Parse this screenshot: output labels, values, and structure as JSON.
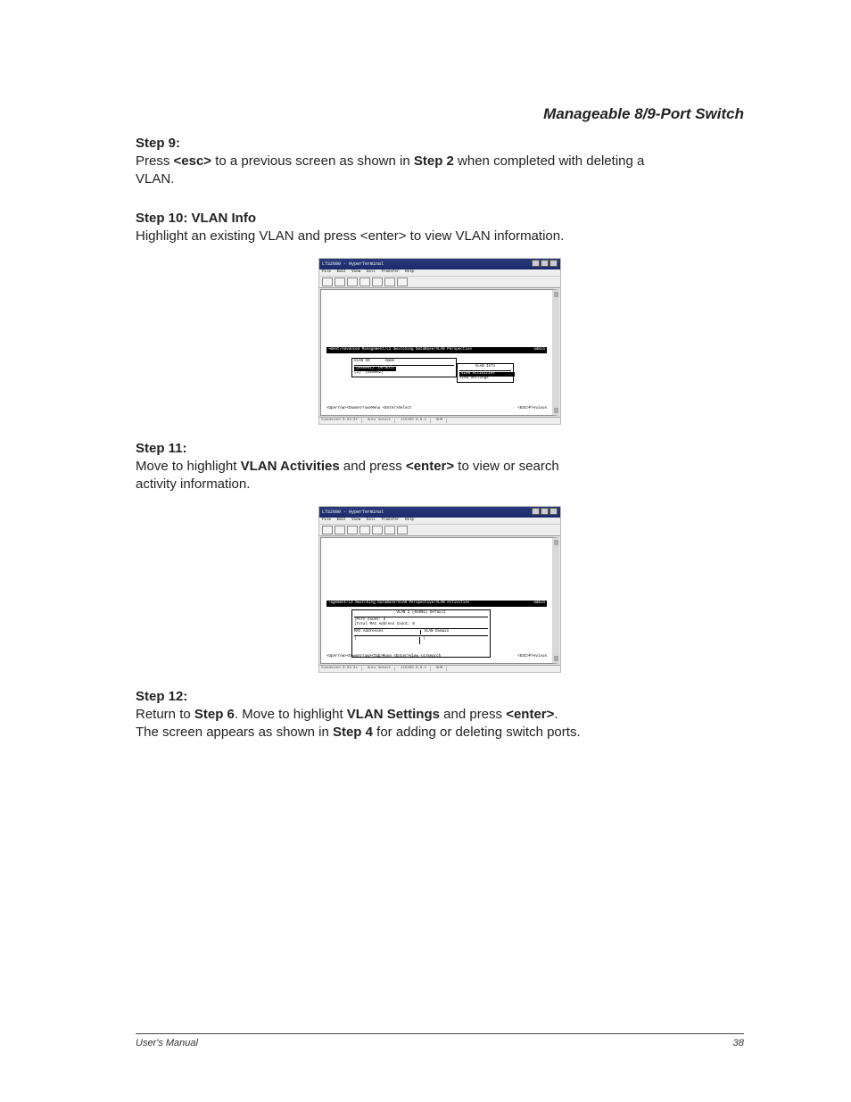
{
  "header": {
    "title": "Manageable 8/9-Port Switch"
  },
  "steps": {
    "s9": {
      "head": "Step 9:",
      "l1a": "Press  ",
      "esc": "<esc>",
      "l1b": "  to a previous screen as shown in ",
      "ref": "Step 2",
      "l1c": " when completed with deleting a",
      "l2": "VLAN."
    },
    "s10": {
      "head": "Step 10: VLAN Info",
      "l1": "Highlight an existing VLAN and press <enter> to view VLAN information."
    },
    "s11": {
      "head": "Step 11:",
      "l1a": "Move to highlight ",
      "b1": "VLAN Activities",
      "l1b": " and press ",
      "b2": "<enter>",
      "l1c": " to view or search",
      "l2": "activity information."
    },
    "s12": {
      "head": "Step 12:",
      "l1a": "Return to ",
      "b1": "Step 6",
      "l1b": ". Move to highlight ",
      "b2": "VLAN Settings",
      "l1c": " and press ",
      "b3": "<enter>",
      "l1d": ".",
      "l2a": "The screen appears as shown in ",
      "b4": "Step 4",
      "l2b": " for adding or deleting switch ports."
    }
  },
  "term_common": {
    "app_title": "LTS2600 - HyperTerminal",
    "menu_file": "File",
    "menu_edit": "Edit",
    "menu_view": "View",
    "menu_call": "Call",
    "menu_transfer": "Transfer",
    "menu_help": "Help",
    "status_conn": "Connected 0:04:34",
    "status_auto": "Auto detect",
    "status_baud": "115200 8-N-1",
    "status_num": "NUM",
    "user": "admin",
    "esc": "<ESC>Previous"
  },
  "shot1": {
    "crumb": "~ment/Advanced Management/L2 Switching DataBase/VLAN Perspective",
    "col_id": "VLAN ID",
    "col_name": "Name",
    "row_id1": "(0x0001)",
    "row_name1": "Default",
    "row_id2": "(0x0002)",
    "panel_title": "VLAN Info",
    "panel_act": "VLAN Activities",
    "panel_set": "VLAN Settings",
    "help": "<UpArrow><DownArrow>Menu  <Enter>Select"
  },
  "shot2": {
    "crumb": "~agement/L2 Switching DataBase/VLAN Perspective/VLAN Activities",
    "title": "VLAN 1 (0x001)  Default",
    "port": "|Port Count: 3",
    "mac": "|Total MAC Address Count: 0",
    "col_mac": "MAC Addresses",
    "col_dom": "VLAN Domain",
    "help": "<UpArrow><DownArrow><Tab>Move <Enter>View <s>Search"
  },
  "footer": {
    "left": "User's Manual",
    "right": "38"
  }
}
